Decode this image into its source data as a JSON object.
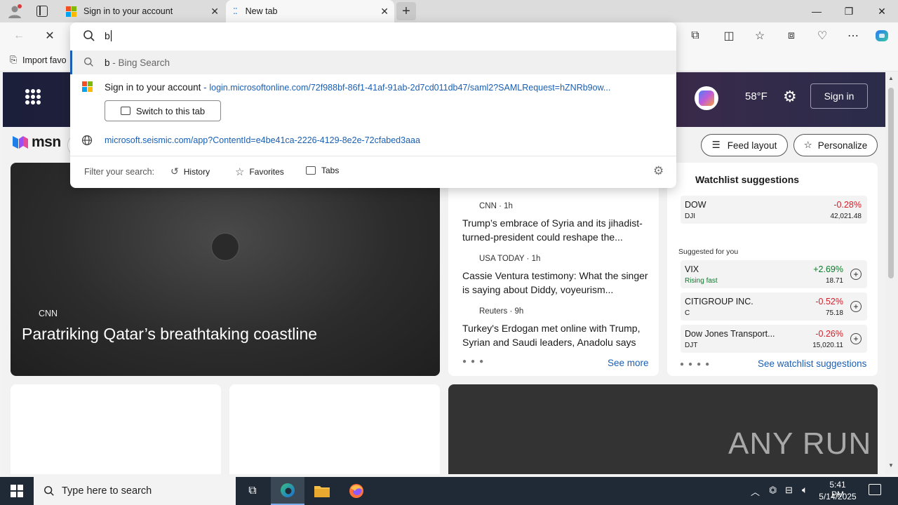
{
  "tabs": [
    {
      "label": "Sign in to your account"
    },
    {
      "label": "New tab"
    }
  ],
  "toolbar": {
    "favorites_import": "Import favo"
  },
  "omnibox": {
    "query": "b",
    "suggestions": [
      {
        "title": "b",
        "suffix": " - Bing Search"
      },
      {
        "title": "Sign in to your account",
        "sep": " - ",
        "url": "login.microsoftonline.com/72f988bf-86f1-41af-91ab-2d7cd011db47/saml2?SAMLRequest=hZNRb9ow..."
      },
      {
        "url": "microsoft.seismic.com/app?ContentId=e4be41ca-2226-4129-8e2e-72cfabed3aaa"
      }
    ],
    "switch_tab": "Switch to this tab",
    "filter_label": "Filter your search:",
    "filters": [
      "History",
      "Favorites",
      "Tabs"
    ]
  },
  "msn": {
    "logo": "msn",
    "temperature": "58°F",
    "sign_in": "Sign in",
    "feed_layout": "Feed layout",
    "personalize": "Personalize",
    "hero": {
      "source": "CNN",
      "headline": "Paratriking Qatar’s breathtaking coastline"
    },
    "news": [
      {
        "source": "CNN · 1h",
        "headline": "Trump’s embrace of Syria and its jihadist-turned-president could reshape the..."
      },
      {
        "source": "USA TODAY · 1h",
        "headline": "Cassie Ventura testimony: What the singer is saying about Diddy, voyeurism..."
      },
      {
        "source": "Reuters · 9h",
        "headline": "Turkey's Erdogan met online with Trump, Syrian and Saudi leaders, Anadolu says"
      }
    ],
    "see_more": "See more",
    "watchlist": {
      "title": "Watchlist suggestions",
      "suggested_label": "Suggested for you",
      "see_all": "See watchlist suggestions",
      "stocks": [
        {
          "name": "DOW",
          "symbol": "DJI",
          "change": "-0.28%",
          "price": "42,021.48",
          "note": "",
          "dir": "neg"
        },
        {
          "name": "VIX",
          "symbol": "",
          "change": "+2.69%",
          "price": "18.71",
          "note": "Rising fast",
          "dir": "pos"
        },
        {
          "name": "CITIGROUP INC.",
          "symbol": "C",
          "change": "-0.52%",
          "price": "75.18",
          "note": "",
          "dir": "neg"
        },
        {
          "name": "Dow Jones Transport...",
          "symbol": "DJT",
          "change": "-0.26%",
          "price": "15,020.11",
          "note": "",
          "dir": "neg"
        }
      ]
    }
  },
  "watermark": "ANY RUN",
  "taskbar": {
    "search_placeholder": "Type here to search",
    "time": "5:41 PM",
    "date": "5/14/2025"
  }
}
